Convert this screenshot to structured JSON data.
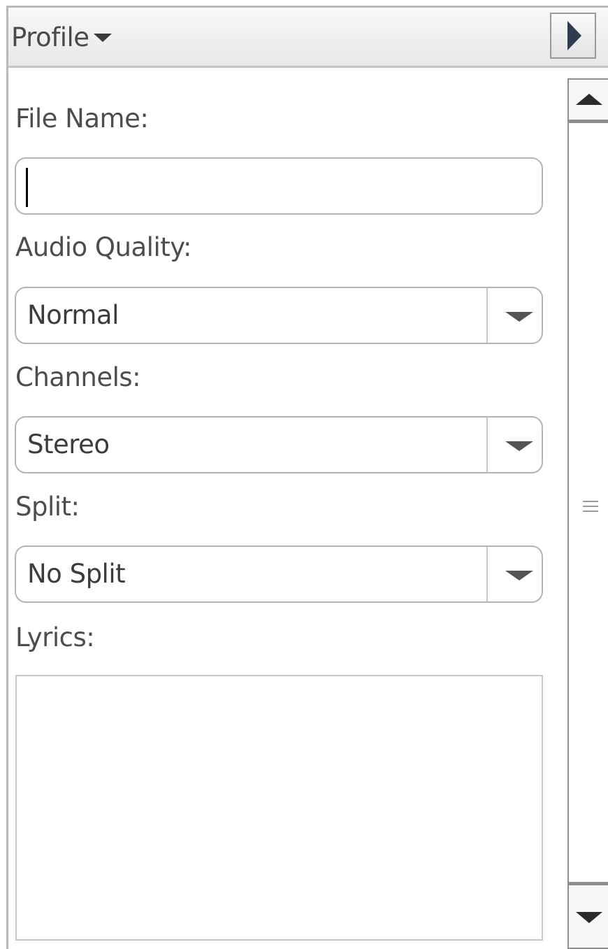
{
  "header": {
    "profile_label": "Profile",
    "profile_arrow_icon": "caret-down-icon",
    "collapse_icon": "play-right-icon"
  },
  "form": {
    "file_name": {
      "label": "File Name:",
      "value": ""
    },
    "audio_quality": {
      "label": "Audio Quality:",
      "selected": "Normal"
    },
    "channels": {
      "label": "Channels:",
      "selected": "Stereo"
    },
    "split": {
      "label": "Split:",
      "selected": "No Split"
    },
    "lyrics": {
      "label": "Lyrics:",
      "value": ""
    }
  },
  "scrollbar": {
    "up_icon": "triangle-up-icon",
    "grip_icon": "grip-lines-icon",
    "down_icon": "triangle-down-icon"
  }
}
